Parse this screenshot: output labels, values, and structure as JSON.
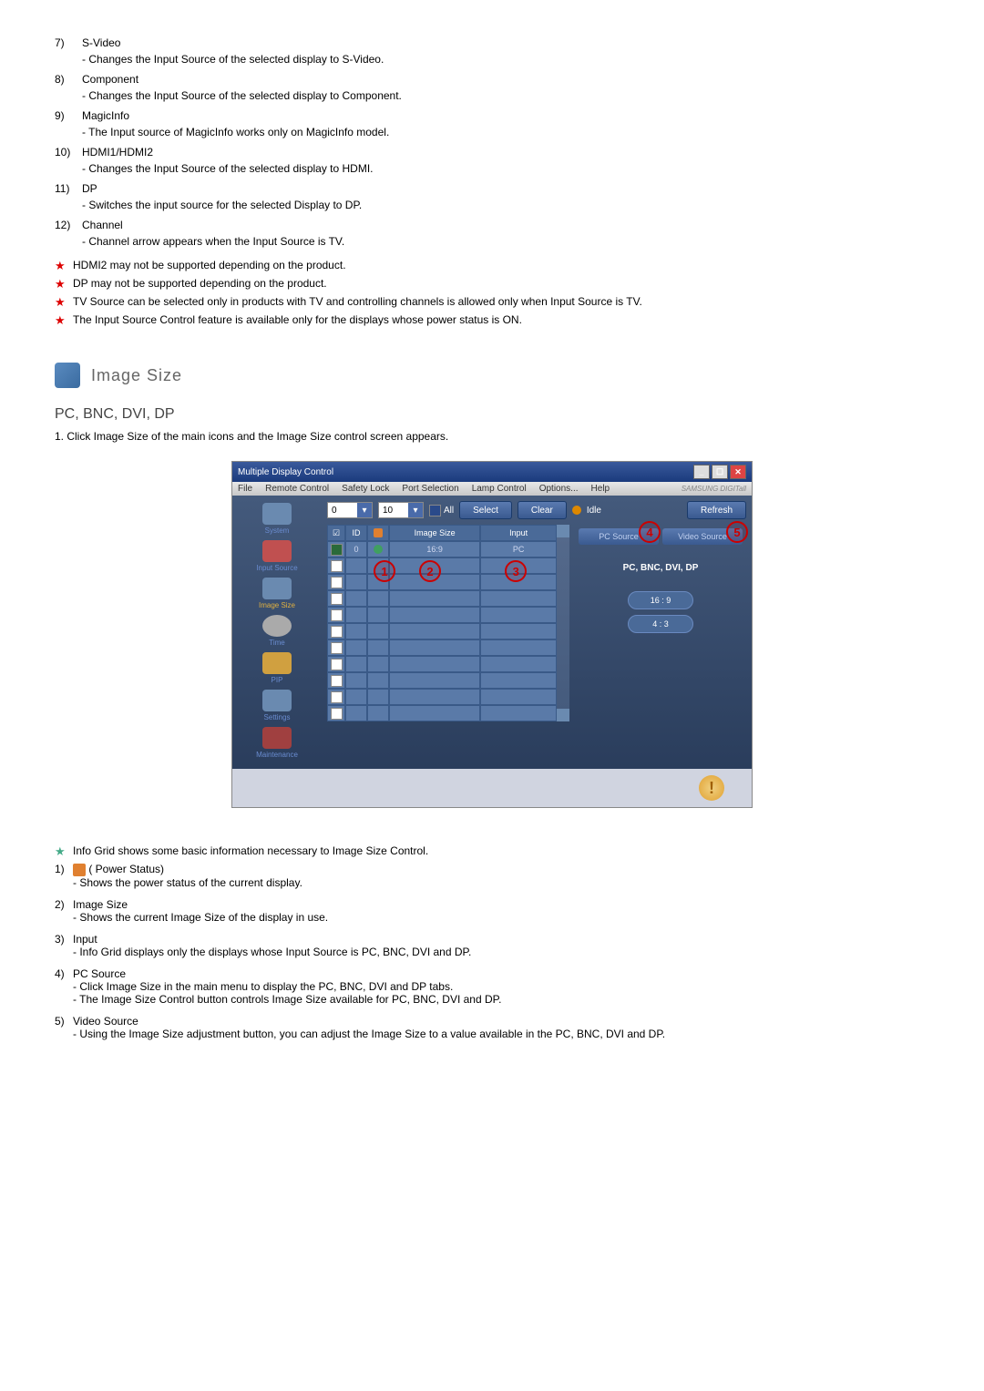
{
  "top_list": [
    {
      "num": "7)",
      "title": "S-Video",
      "desc": "- Changes the Input Source of the selected display to S-Video."
    },
    {
      "num": "8)",
      "title": "Component",
      "desc": "- Changes the Input Source of the selected display to Component."
    },
    {
      "num": "9)",
      "title": "MagicInfo",
      "desc": "- The Input source of MagicInfo works only on MagicInfo model."
    },
    {
      "num": "10)",
      "title": "HDMI1/HDMI2",
      "desc": "- Changes the Input Source of the selected display to HDMI."
    },
    {
      "num": "11)",
      "title": "DP",
      "desc": "- Switches the input source for the selected Display to DP."
    },
    {
      "num": "12)",
      "title": "Channel",
      "desc": "- Channel arrow appears when the Input Source is TV."
    }
  ],
  "star_notes": [
    "HDMI2 may not be supported depending on the product.",
    "DP may not be supported depending on the product.",
    "TV Source can be selected only in products with TV and controlling channels is allowed only when Input Source is TV.",
    "The Input Source Control feature is available only for the displays whose power status is ON."
  ],
  "section": {
    "title": "Image Size",
    "subtitle": "PC, BNC, DVI, DP",
    "step1": "1. Click Image Size of the main icons and the Image Size control screen appears."
  },
  "app": {
    "title": "Multiple Display Control",
    "menu": [
      "File",
      "Remote Control",
      "Safety Lock",
      "Port Selection",
      "Lamp Control",
      "Options...",
      "Help"
    ],
    "brand": "SAMSUNG DIGITall",
    "sidebar": [
      {
        "label": "System"
      },
      {
        "label": "Input Source"
      },
      {
        "label": "Image Size"
      },
      {
        "label": "Time"
      },
      {
        "label": "PIP"
      },
      {
        "label": "Settings"
      },
      {
        "label": "Maintenance"
      }
    ],
    "dropdown1": "0",
    "dropdown2": "10",
    "all_label": "All",
    "buttons": {
      "select": "Select",
      "clear": "Clear",
      "refresh": "Refresh"
    },
    "idle": "Idle",
    "tabs": {
      "pc": "PC Source",
      "video": "Video Source"
    },
    "grid": {
      "headers": {
        "id": "ID",
        "size": "Image Size",
        "input": "Input"
      },
      "row": {
        "id": "0",
        "size": "16:9",
        "input": "PC"
      }
    },
    "right": {
      "title": "PC, BNC, DVI, DP",
      "r169": "16 : 9",
      "r43": "4 : 3"
    }
  },
  "bottom_star": "Info Grid shows some basic information necessary to Image Size Control.",
  "bottom_list": [
    {
      "num": "1)",
      "title": "( Power Status)",
      "has_icon": true,
      "descs": [
        "- Shows the power status of the current display."
      ]
    },
    {
      "num": "2)",
      "title": "Image Size",
      "descs": [
        "- Shows the current Image Size of the display in use."
      ]
    },
    {
      "num": "3)",
      "title": "Input",
      "descs": [
        "- Info Grid displays only the displays whose Input Source is PC, BNC, DVI and DP."
      ]
    },
    {
      "num": "4)",
      "title": "PC Source",
      "descs": [
        "- Click Image Size in the main menu to display the PC, BNC, DVI and DP tabs.",
        "- The Image Size Control button controls Image Size available for PC, BNC, DVI and DP."
      ]
    },
    {
      "num": "5)",
      "title": "Video Source",
      "descs": [
        "- Using the Image Size adjustment button, you can adjust the Image Size to a value available in the PC, BNC, DVI and DP."
      ]
    }
  ]
}
